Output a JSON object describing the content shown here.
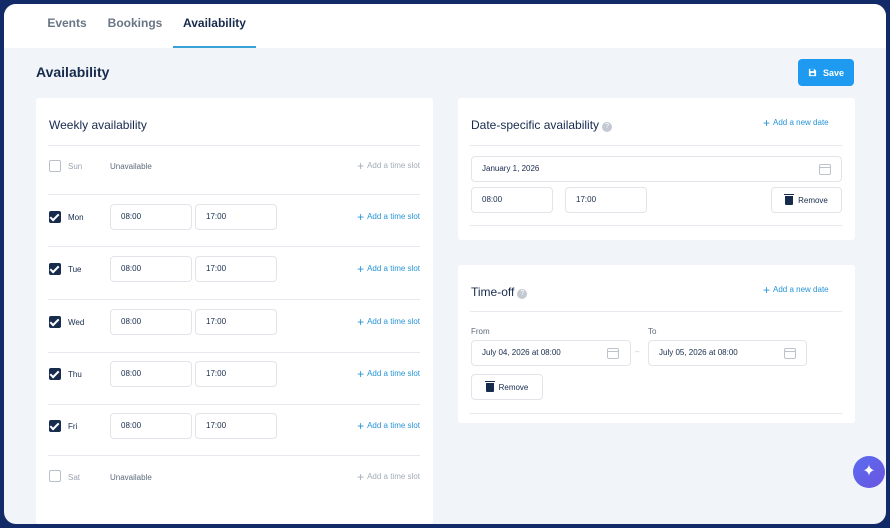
{
  "tabs": [
    {
      "label": "Events",
      "active": false
    },
    {
      "label": "Bookings",
      "active": false
    },
    {
      "label": "Availability",
      "active": true
    }
  ],
  "header": {
    "title": "Availability",
    "save_label": "Save"
  },
  "weekly": {
    "title": "Weekly availability",
    "add_slot_label": "Add a time slot",
    "days": [
      {
        "day": "Sun",
        "checked": false,
        "status": "Unavailable"
      },
      {
        "day": "Mon",
        "checked": true,
        "start": "08:00",
        "end": "17:00"
      },
      {
        "day": "Tue",
        "checked": true,
        "start": "08:00",
        "end": "17:00"
      },
      {
        "day": "Wed",
        "checked": true,
        "start": "08:00",
        "end": "17:00"
      },
      {
        "day": "Thu",
        "checked": true,
        "start": "08:00",
        "end": "17:00"
      },
      {
        "day": "Fri",
        "checked": true,
        "start": "08:00",
        "end": "17:00"
      },
      {
        "day": "Sat",
        "checked": false,
        "status": "Unavailable"
      }
    ]
  },
  "date_specific": {
    "title": "Date-specific availability",
    "add_label": "Add a new date",
    "date": "January 1, 2026",
    "start": "08:00",
    "end": "17:00",
    "remove_label": "Remove"
  },
  "time_off": {
    "title": "Time-off",
    "add_label": "Add a new date",
    "from_label": "From",
    "to_label": "To",
    "from_value": "July 04, 2026 at 08:00",
    "to_value": "July 05, 2026 at 08:00",
    "remove_label": "Remove"
  },
  "colors": {
    "accent": "#1e9bf0",
    "navy": "#172b4d",
    "background": "#f1f4f8"
  },
  "icons": {
    "save": "floppy-disk-icon",
    "help": "question-circle-icon",
    "calendar": "calendar-icon",
    "trash": "trash-icon",
    "assistant": "sparkle-icon"
  }
}
